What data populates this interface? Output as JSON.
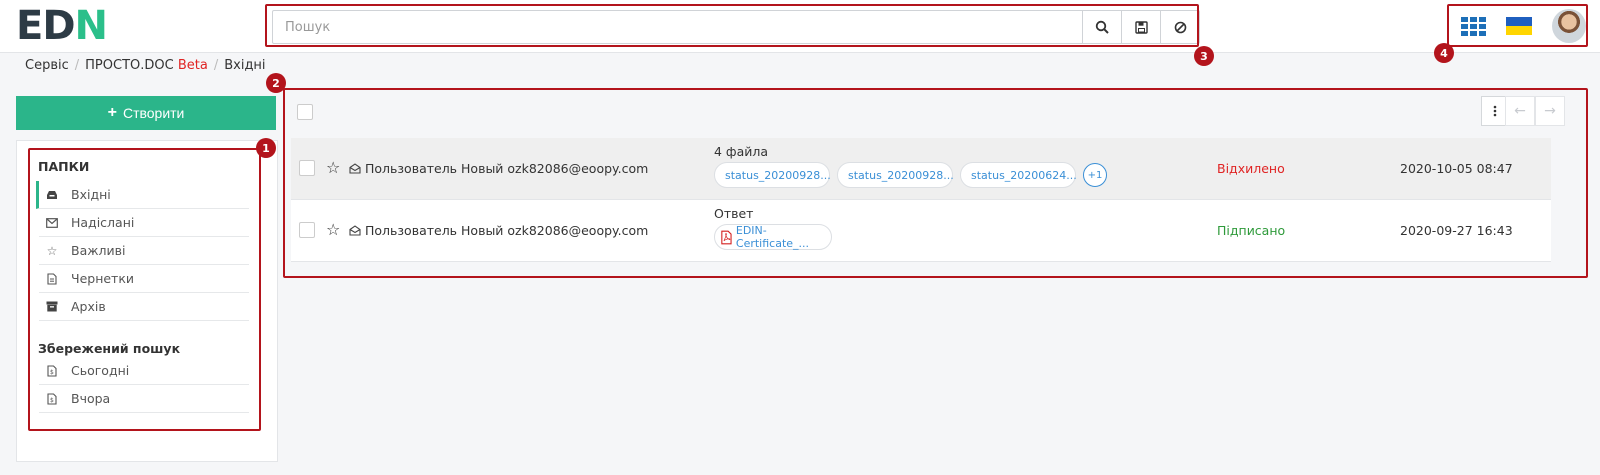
{
  "logo": {
    "part1": "ED",
    "part2": "N"
  },
  "search": {
    "placeholder": "Пошук"
  },
  "breadcrumb": {
    "items": [
      "Сервіс",
      "ПРОСТО.DOC",
      "Вхідні"
    ],
    "beta": "Beta"
  },
  "create_button": {
    "label": "Створити"
  },
  "sidebar": {
    "folders_title": "ПАПКИ",
    "folders": [
      {
        "label": "Вхідні",
        "icon": "inbox-icon"
      },
      {
        "label": "Надіслані",
        "icon": "envelope-icon"
      },
      {
        "label": "Важливі",
        "icon": "star-icon"
      },
      {
        "label": "Чернетки",
        "icon": "draft-icon"
      },
      {
        "label": "Архів",
        "icon": "archive-icon"
      }
    ],
    "saved_title": "Збережений пошук",
    "saved": [
      {
        "label": "Сьогодні",
        "icon": "saved-search-icon"
      },
      {
        "label": "Вчора",
        "icon": "saved-search-icon"
      }
    ]
  },
  "documents": [
    {
      "sender": "Пользователь Новый ozk82086@eoopy.com",
      "subject": "4 файла",
      "files": [
        "status_20200928...",
        "status_20200928...",
        "status_20200624..."
      ],
      "more": "+1",
      "status": "Відхилено",
      "date": "2020-10-05 08:47"
    },
    {
      "sender": "Пользователь Новый ozk82086@eoopy.com",
      "subject": "Ответ",
      "files": [
        "EDIN-Certificate_..."
      ],
      "status": "Підписано",
      "date": "2020-09-27 16:43"
    }
  ],
  "annotations": [
    "1",
    "2",
    "3",
    "4"
  ],
  "colors": {
    "accent": "#2bb58a",
    "link": "#3a8fd6",
    "rejected": "#e02424",
    "signed": "#2e9a3a",
    "annotation": "#b3141c"
  }
}
